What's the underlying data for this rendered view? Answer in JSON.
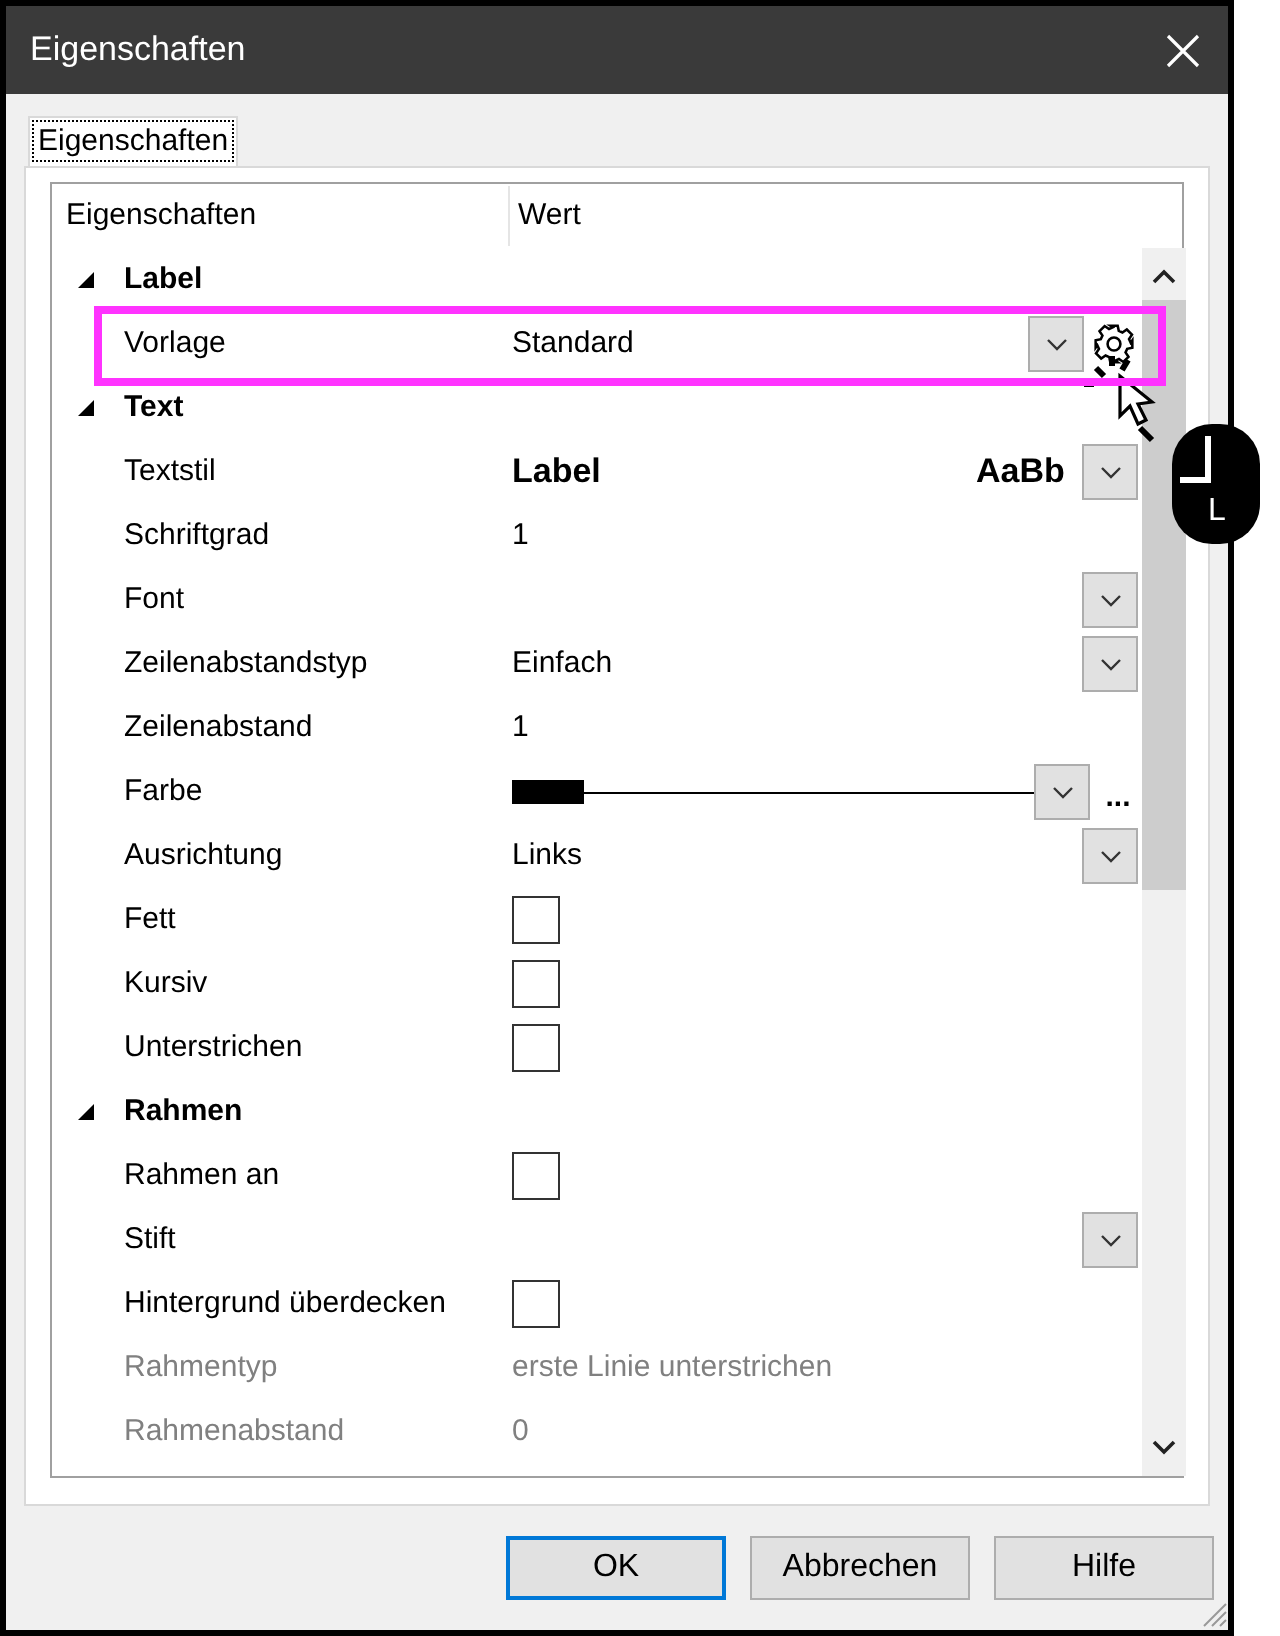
{
  "window": {
    "title": "Eigenschaften"
  },
  "tabs": [
    {
      "label": "Eigenschaften",
      "selected": true
    }
  ],
  "grid": {
    "columns": [
      "Eigenschaften",
      "Wert"
    ],
    "sections": [
      {
        "title": "Label",
        "expanded": true,
        "rows": [
          {
            "kind": "template",
            "name": "Vorlage",
            "value": "Standard",
            "highlighted": true,
            "disabled": false
          }
        ]
      },
      {
        "title": "Text",
        "expanded": true,
        "rows": [
          {
            "kind": "style",
            "name": "Textstil",
            "value": "Label",
            "preview": "AaBb",
            "disabled": false
          },
          {
            "kind": "text",
            "name": "Schriftgrad",
            "value": "1",
            "disabled": false
          },
          {
            "kind": "dropdown",
            "name": "Font",
            "disabled": false
          },
          {
            "kind": "dropdown",
            "name": "Zeilenabstandstyp",
            "value": "Einfach",
            "disabled": false
          },
          {
            "kind": "text",
            "name": "Zeilenabstand",
            "value": "1",
            "disabled": false
          },
          {
            "kind": "color",
            "name": "Farbe",
            "color": "#000000",
            "more": "...",
            "disabled": false
          },
          {
            "kind": "dropdown",
            "name": "Ausrichtung",
            "value": "Links",
            "disabled": false
          },
          {
            "kind": "checkbox",
            "name": "Fett",
            "checked": false,
            "disabled": false
          },
          {
            "kind": "checkbox",
            "name": "Kursiv",
            "checked": false,
            "disabled": false
          },
          {
            "kind": "checkbox",
            "name": "Unterstrichen",
            "checked": false,
            "disabled": false
          }
        ]
      },
      {
        "title": "Rahmen",
        "expanded": true,
        "rows": [
          {
            "kind": "checkbox",
            "name": "Rahmen an",
            "checked": false,
            "disabled": false
          },
          {
            "kind": "dropdown",
            "name": "Stift",
            "disabled": false
          },
          {
            "kind": "checkbox",
            "name": "Hintergrund überdecken",
            "checked": false,
            "disabled": false
          },
          {
            "kind": "text",
            "name": "Rahmentyp",
            "value": "erste Linie unterstrichen",
            "disabled": true
          },
          {
            "kind": "text",
            "name": "Rahmenabstand",
            "value": "0",
            "disabled": true
          }
        ]
      }
    ]
  },
  "annotation": {
    "mouse_button": "L"
  },
  "buttons": [
    {
      "label": "OK",
      "default": true
    },
    {
      "label": "Abbrechen",
      "default": false
    },
    {
      "label": "Hilfe",
      "default": false
    }
  ]
}
